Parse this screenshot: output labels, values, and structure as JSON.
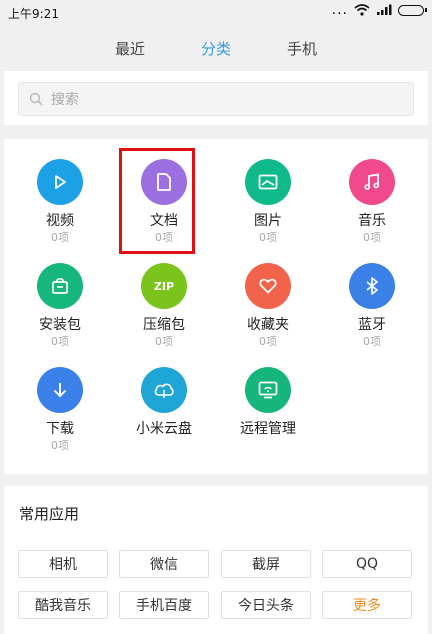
{
  "status": {
    "time": "上午9:21",
    "dots": "...",
    "signal_label": "ıll"
  },
  "tabs": [
    {
      "label": "最近"
    },
    {
      "label": "分类"
    },
    {
      "label": "手机"
    }
  ],
  "search": {
    "placeholder": "搜索"
  },
  "categories": [
    {
      "name": "视频",
      "count": "0项",
      "color": "#1da1e6",
      "icon": "play-icon"
    },
    {
      "name": "文档",
      "count": "0项",
      "color": "#9b6fe0",
      "icon": "document-icon"
    },
    {
      "name": "图片",
      "count": "0项",
      "color": "#10b98a",
      "icon": "image-icon"
    },
    {
      "name": "音乐",
      "count": "0项",
      "color": "#f04a8c",
      "icon": "music-icon"
    },
    {
      "name": "安装包",
      "count": "0项",
      "color": "#16b77d",
      "icon": "package-icon"
    },
    {
      "name": "压缩包",
      "count": "0项",
      "color": "#7ac41c",
      "icon": "zip-icon",
      "icon_text": "ZIP"
    },
    {
      "name": "收藏夹",
      "count": "0项",
      "color": "#f2634b",
      "icon": "heart-icon"
    },
    {
      "name": "蓝牙",
      "count": "0项",
      "color": "#3b80e6",
      "icon": "bluetooth-icon"
    },
    {
      "name": "下载",
      "count": "0项",
      "color": "#3b7fe8",
      "icon": "download-icon"
    },
    {
      "name": "小米云盘",
      "count": "",
      "color": "#1fa6d6",
      "icon": "cloud-icon"
    },
    {
      "name": "远程管理",
      "count": "",
      "color": "#16b57b",
      "icon": "remote-icon"
    }
  ],
  "common_apps": {
    "title": "常用应用",
    "items": [
      "相机",
      "微信",
      "截屏",
      "QQ",
      "酷我音乐",
      "手机百度",
      "今日头条",
      "更多"
    ]
  },
  "colors": {
    "accent": "#3a9bd9",
    "highlight": "#e01010",
    "more": "#f08a24"
  }
}
